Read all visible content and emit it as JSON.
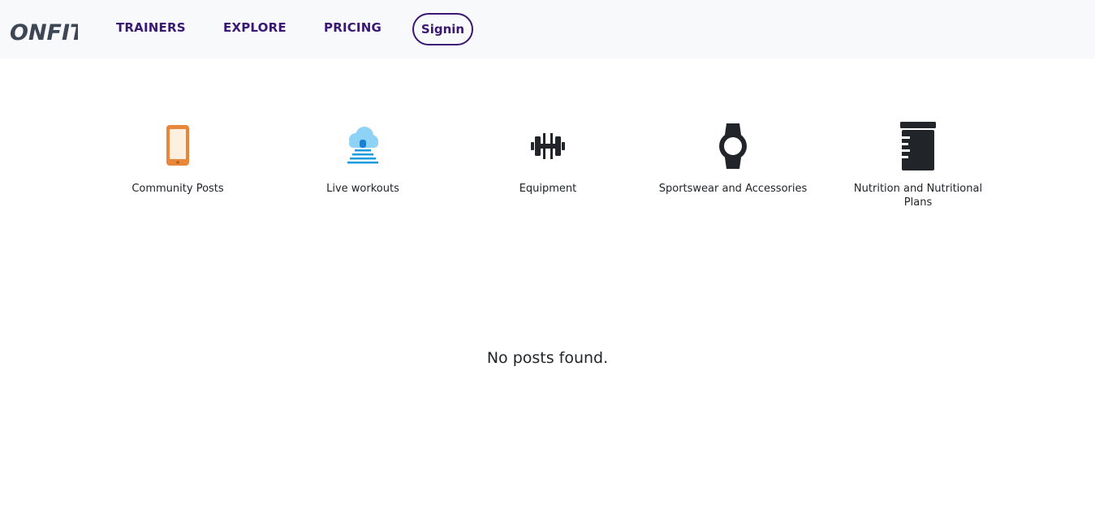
{
  "brand": {
    "logo_text": "ONFIT"
  },
  "nav": {
    "links": [
      "TRAINERS",
      "EXPLORE",
      "PRICING"
    ],
    "signin_label": "Signin",
    "accent_color": "#3a1772"
  },
  "categories": [
    {
      "label": "Community Posts",
      "icon": "smartphone-icon",
      "color": "#e8873a"
    },
    {
      "label": "Live workouts",
      "icon": "cloud-stream-icon",
      "color": "#3da9e8"
    },
    {
      "label": "Equipment",
      "icon": "dumbbell-icon",
      "color": "#212529"
    },
    {
      "label": "Sportswear and Accessories",
      "icon": "smartwatch-icon",
      "color": "#212529"
    },
    {
      "label": "Nutrition and Nutritional Plans",
      "icon": "supplement-jar-icon",
      "color": "#212529"
    }
  ],
  "main": {
    "empty_message": "No posts found."
  }
}
